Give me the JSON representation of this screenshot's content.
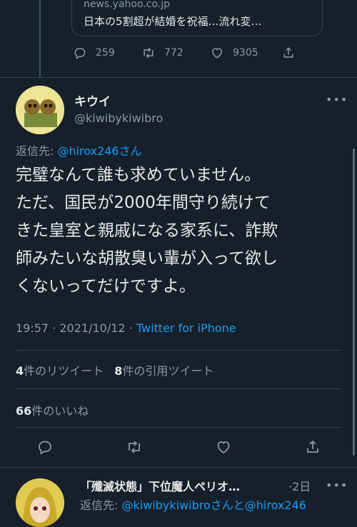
{
  "previous_tweet": {
    "card_domain": "news.yahoo.co.jp",
    "card_title": "日本の5割超が結婚を祝福…流れ変…",
    "reply_count": "259",
    "retweet_count": "772",
    "like_count": "9305"
  },
  "tweet": {
    "display_name": "キウイ",
    "handle": "@kiwibykiwibro",
    "reply_prefix": "返信先: ",
    "reply_handle": "@hirox246さん",
    "text_lines": [
      "完璧なんて誰も求めていません。",
      "ただ、国民が2000年間守り続けて",
      "きた皇室と親戚になる家系に、詐欺",
      "師みたいな胡散臭い輩が入って欲し",
      "くないってだけですよ。"
    ],
    "time": "19:57",
    "date": "2021/10/12",
    "source": "Twitter for iPhone",
    "retweets": "4",
    "retweets_label": "件のリツイート",
    "quotes": "8",
    "quotes_label": "件の引用ツイート",
    "likes": "66",
    "likes_label": "件のいいね"
  },
  "next_reply": {
    "name": "「殲滅状態」下位魔人ペリオ…",
    "time": "·2日",
    "reply_prefix": "返信先: ",
    "reply_handles": "@kiwibykiwibroさんと@hirox246"
  },
  "icons": {
    "reply": "reply-icon",
    "retweet": "retweet-icon",
    "like": "heart-icon",
    "share": "share-icon",
    "more": "more-icon"
  },
  "colors": {
    "background": "#15202b",
    "text": "#e7e9ea",
    "muted": "#8b98a5",
    "accent": "#1d9bf0",
    "border": "#38444d"
  }
}
